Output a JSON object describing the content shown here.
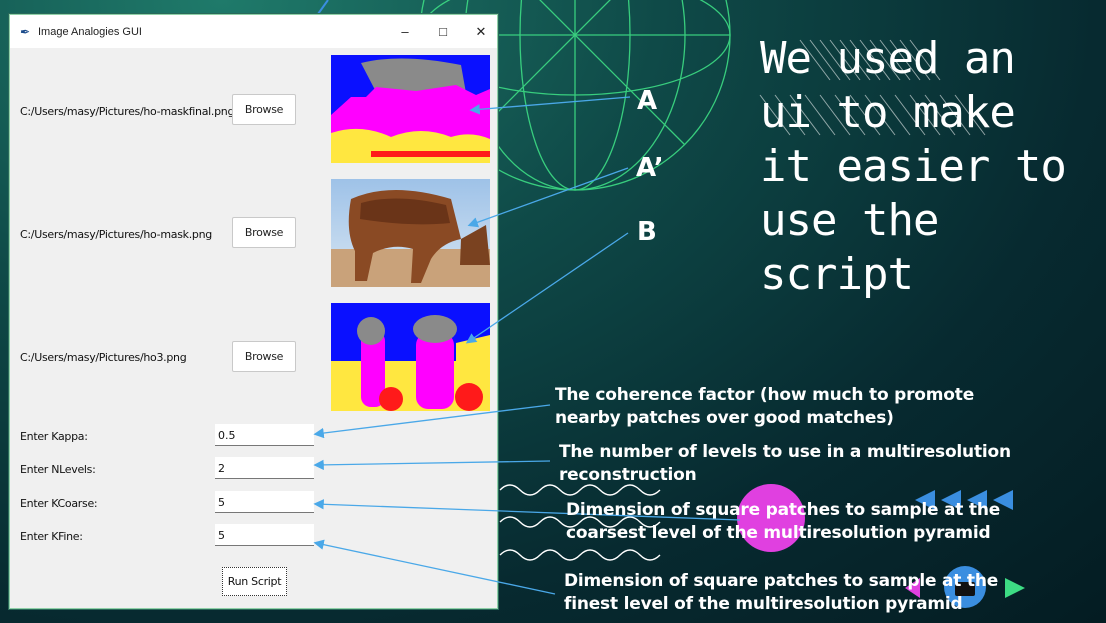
{
  "window": {
    "title": "Image Analogies GUI",
    "controls": [
      "–",
      "□",
      "✕"
    ],
    "images": [
      {
        "path": "C:/Users/masy/Pictures/ho-maskfinal.png",
        "browse_label": "Browse"
      },
      {
        "path": "C:/Users/masy/Pictures/ho-mask.png",
        "browse_label": "Browse"
      },
      {
        "path": "C:/Users/masy/Pictures/ho3.png",
        "browse_label": "Browse"
      }
    ],
    "params": [
      {
        "label": "Enter Kappa:",
        "value": "0.5"
      },
      {
        "label": "Enter NLevels:",
        "value": "2"
      },
      {
        "label": "Enter KCoarse:",
        "value": "5"
      },
      {
        "label": "Enter KFine:",
        "value": "5"
      }
    ],
    "run_label": "Run Script"
  },
  "slide": {
    "heading": "We used an ui to make it easier to use the script",
    "letters": [
      "A",
      "A’",
      "B"
    ],
    "descriptions": [
      "The coherence factor (how much to promote nearby patches over good matches)",
      "The number of levels to use in a multiresolution reconstruction",
      "Dimension of square patches to sample at the coarsest level of the multiresolution pyramid",
      "Dimension of square patches to sample at the finest level of the multiresolution pyramid"
    ]
  },
  "colors": {
    "bg_dark": "#072a30",
    "accent_green": "#3ddc84",
    "accent_blue": "#3a8ee0",
    "accent_magenta": "#e040e0",
    "arrow": "#4aa8e8"
  }
}
